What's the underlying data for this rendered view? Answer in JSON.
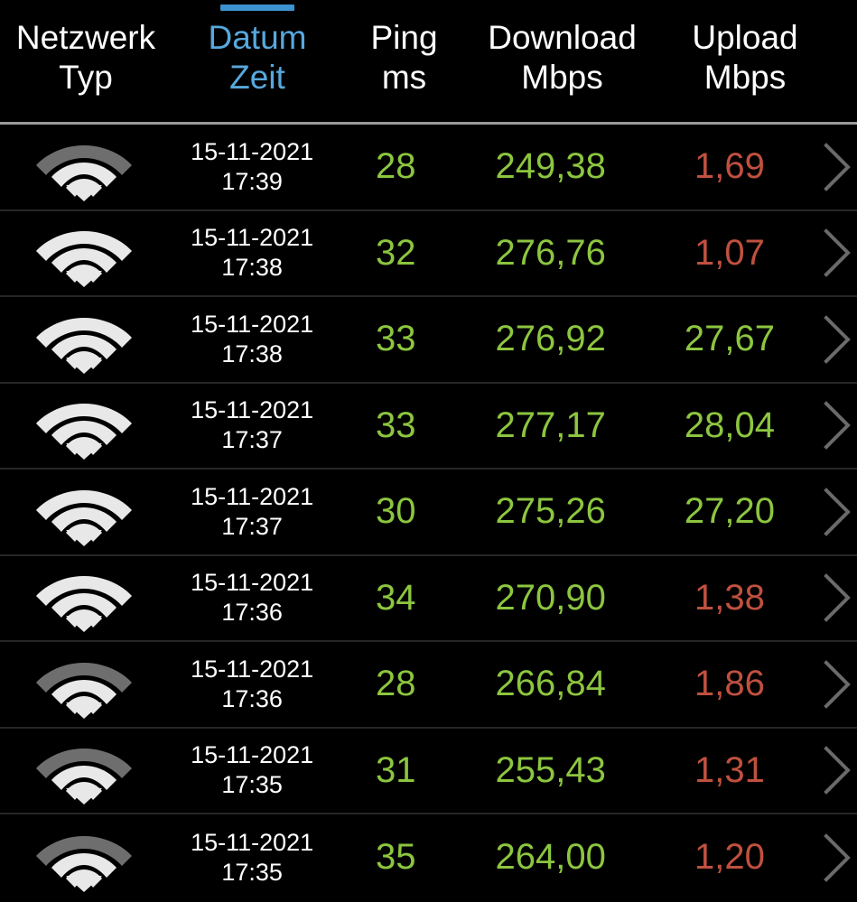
{
  "header": {
    "columns": [
      {
        "key": "network",
        "line1": "Netzwerk",
        "line2": "Typ",
        "active": false
      },
      {
        "key": "date",
        "line1": "Datum",
        "line2": "Zeit",
        "active": true
      },
      {
        "key": "ping",
        "line1": "Ping",
        "line2": "ms",
        "active": false
      },
      {
        "key": "down",
        "line1": "Download",
        "line2": "Mbps",
        "active": false
      },
      {
        "key": "up",
        "line1": "Upload",
        "line2": "Mbps",
        "active": false
      }
    ]
  },
  "colors": {
    "background": "#000000",
    "accent_blue": "#3d93cf",
    "active_text_blue": "#57a8dd",
    "value_green": "#8cc63f",
    "value_red": "#c0503f",
    "text_white": "#ffffff",
    "separator": "#262626",
    "header_separator": "#9a9a9a",
    "wifi_arc_active": "#e8e8e8",
    "wifi_arc_dim": "#6e6e6e",
    "chevron": "#6a6a6a"
  },
  "icons": {
    "wifi": "wifi-icon",
    "chevron": "chevron-right-icon"
  },
  "rows": [
    {
      "network_icon": "wifi-icon",
      "signal_bars": 3,
      "date": "15-11-2021",
      "time": "17:39",
      "ping": "28",
      "download": "249,38",
      "upload": "1,69",
      "upload_state": "bad"
    },
    {
      "network_icon": "wifi-icon",
      "signal_bars": 4,
      "date": "15-11-2021",
      "time": "17:38",
      "ping": "32",
      "download": "276,76",
      "upload": "1,07",
      "upload_state": "bad"
    },
    {
      "network_icon": "wifi-icon",
      "signal_bars": 4,
      "date": "15-11-2021",
      "time": "17:38",
      "ping": "33",
      "download": "276,92",
      "upload": "27,67",
      "upload_state": "good"
    },
    {
      "network_icon": "wifi-icon",
      "signal_bars": 4,
      "date": "15-11-2021",
      "time": "17:37",
      "ping": "33",
      "download": "277,17",
      "upload": "28,04",
      "upload_state": "good"
    },
    {
      "network_icon": "wifi-icon",
      "signal_bars": 4,
      "date": "15-11-2021",
      "time": "17:37",
      "ping": "30",
      "download": "275,26",
      "upload": "27,20",
      "upload_state": "good"
    },
    {
      "network_icon": "wifi-icon",
      "signal_bars": 4,
      "date": "15-11-2021",
      "time": "17:36",
      "ping": "34",
      "download": "270,90",
      "upload": "1,38",
      "upload_state": "bad"
    },
    {
      "network_icon": "wifi-icon",
      "signal_bars": 3,
      "date": "15-11-2021",
      "time": "17:36",
      "ping": "28",
      "download": "266,84",
      "upload": "1,86",
      "upload_state": "bad"
    },
    {
      "network_icon": "wifi-icon",
      "signal_bars": 3,
      "date": "15-11-2021",
      "time": "17:35",
      "ping": "31",
      "download": "255,43",
      "upload": "1,31",
      "upload_state": "bad"
    },
    {
      "network_icon": "wifi-icon",
      "signal_bars": 3,
      "date": "15-11-2021",
      "time": "17:35",
      "ping": "35",
      "download": "264,00",
      "upload": "1,20",
      "upload_state": "bad"
    }
  ]
}
